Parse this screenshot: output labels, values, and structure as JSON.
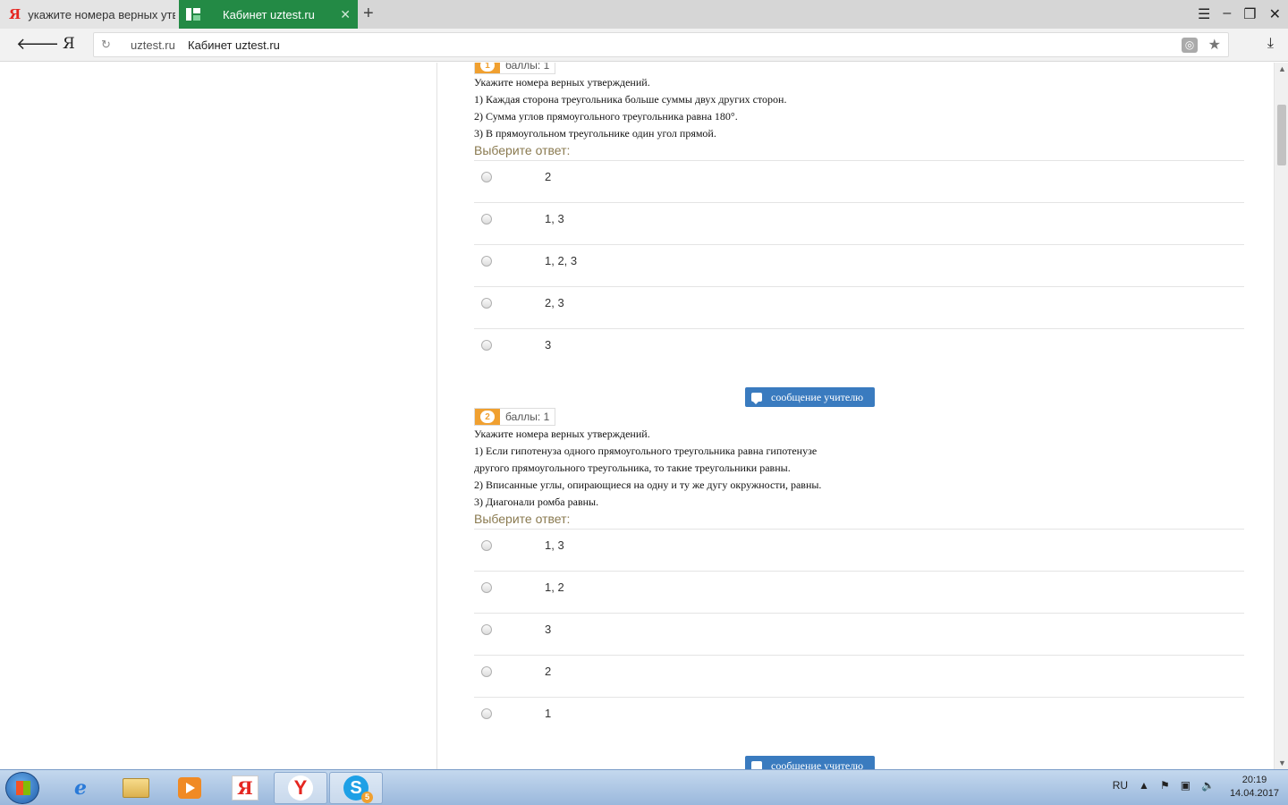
{
  "browser": {
    "tabs": [
      {
        "label": "укажите номера верных утверждений",
        "active": false
      },
      {
        "label": "Кабинет uztest.ru",
        "active": true
      }
    ],
    "new_tab": "+",
    "address": {
      "domain": "uztest.ru",
      "title": "Кабинет uztest.ru"
    }
  },
  "questions": [
    {
      "number": "1",
      "score": "баллы: 1",
      "lines": [
        "Укажите номера верных утверждений.",
        "1) Каждая сторона треугольника больше суммы двух других сторон.",
        "2) Сумма углов прямоугольного треугольника равна 180°.",
        "3) В прямоугольном треугольнике один угол прямой."
      ],
      "choose_label": "Выберите ответ:",
      "answers": [
        "2",
        "1, 3",
        "1, 2, 3",
        "2, 3",
        "3"
      ]
    },
    {
      "number": "2",
      "score": "баллы: 1",
      "lines": [
        "Укажите номера верных утверждений.",
        "1) Если гипотенуза одного прямоугольного треугольника равна гипотенузе",
        "другого прямоугольного треугольника, то такие треугольники равны.",
        "2) Вписанные углы, опирающиеся на одну и ту же дугу окружности, равны.",
        "3) Диагонали ромба равны."
      ],
      "choose_label": "Выберите ответ:",
      "answers": [
        "1, 3",
        "1, 2",
        "3",
        "2",
        "1"
      ]
    }
  ],
  "message_button_label": "сообщение учителю",
  "taskbar": {
    "language": "RU",
    "time": "20:19",
    "date": "14.04.2017",
    "skype_badge": "5"
  },
  "colors": {
    "active_tab": "#238a45",
    "badge": "#f0a030",
    "message_button": "#3a7bbf"
  }
}
